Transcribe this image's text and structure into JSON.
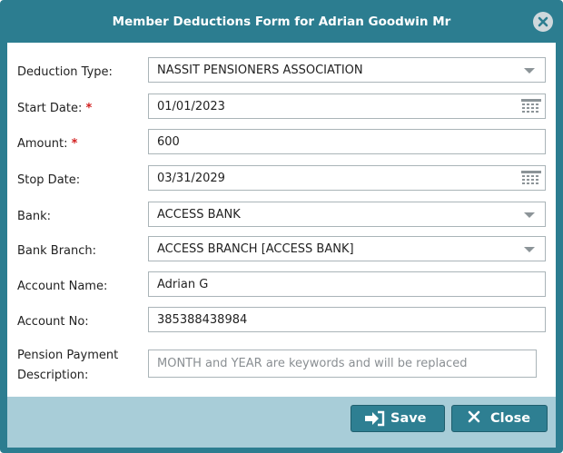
{
  "dialog": {
    "title": "Member Deductions Form for Adrian Goodwin Mr"
  },
  "form": {
    "deduction_type": {
      "label": "Deduction Type:",
      "value": "NASSIT PENSIONERS ASSOCIATION"
    },
    "start_date": {
      "label": "Start Date:",
      "required_mark": "*",
      "value": "01/01/2023"
    },
    "amount": {
      "label": "Amount:",
      "required_mark": "*",
      "value": "600"
    },
    "stop_date": {
      "label": "Stop Date:",
      "value": "03/31/2029"
    },
    "bank": {
      "label": "Bank:",
      "value": "ACCESS BANK"
    },
    "bank_branch": {
      "label": "Bank Branch:",
      "value": "ACCESS BRANCH [ACCESS BANK]"
    },
    "account_name": {
      "label": "Account Name:",
      "value": "Adrian G"
    },
    "account_no": {
      "label": "Account No:",
      "value": "385388438984"
    },
    "pension_payment_description": {
      "label_line1": "Pension Payment",
      "label_line2": "Description:",
      "value": "",
      "placeholder": "MONTH and YEAR are keywords and will be replaced"
    }
  },
  "buttons": {
    "save_label": "Save",
    "close_label": "Close"
  },
  "icons": {
    "close": "close-circle-icon",
    "calendar": "calendar-icon",
    "dropdown": "chevron-down-icon",
    "save": "sign-in-arrow-icon",
    "close_btn": "x-icon"
  },
  "colors": {
    "titlebar": "#2c7d90",
    "footer": "#a8cdd8",
    "button": "#2e7f92",
    "required": "#d21f1f"
  }
}
